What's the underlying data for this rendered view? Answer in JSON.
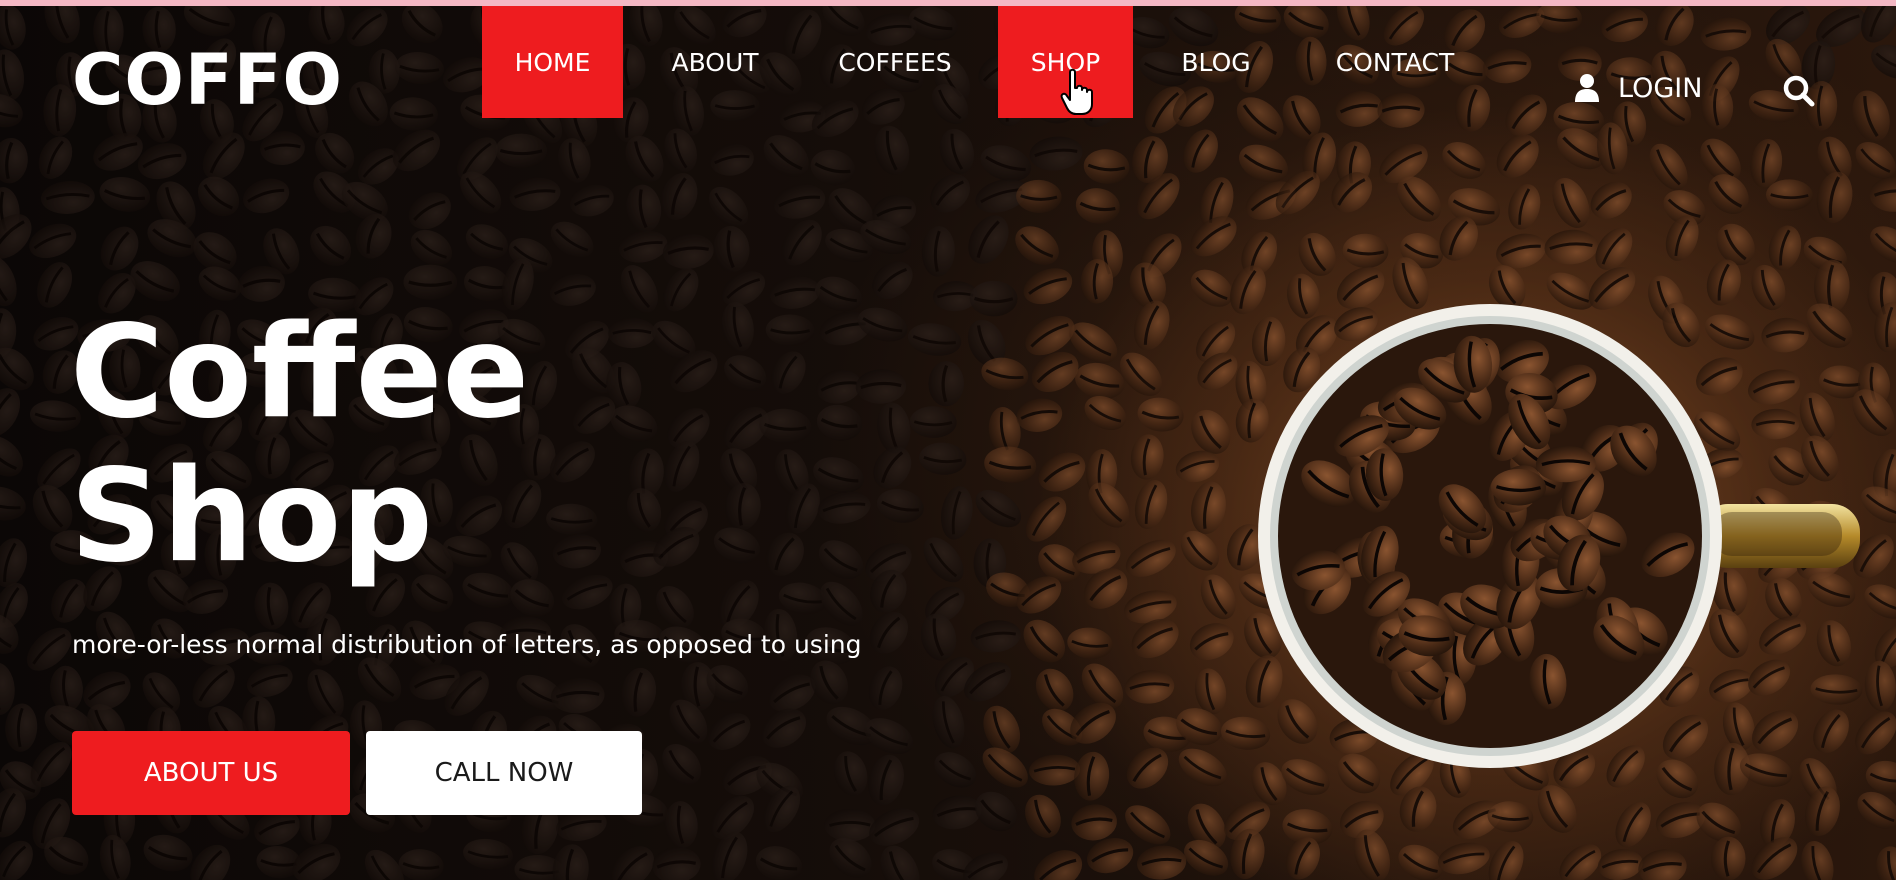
{
  "brand": {
    "logo_text": "COFFO"
  },
  "nav": {
    "items": [
      {
        "label": "HOME",
        "active": true
      },
      {
        "label": "ABOUT",
        "active": false
      },
      {
        "label": "COFFEES",
        "active": false
      },
      {
        "label": "SHOP",
        "active": true
      },
      {
        "label": "BLOG",
        "active": false
      },
      {
        "label": "CONTACT",
        "active": false
      }
    ],
    "login_label": "LOGIN"
  },
  "hero": {
    "title_line1": "Coffee",
    "title_line2": "Shop",
    "subtitle": "more-or-less normal distribution of letters, as opposed to using",
    "primary_button": "ABOUT US",
    "secondary_button": "CALL NOW"
  },
  "icons": {
    "user": "user-icon",
    "search": "search-icon",
    "cursor": "hand-pointer-icon"
  },
  "colors": {
    "accent": "#ee1c1f",
    "text": "#ffffff",
    "button_alt_bg": "#ffffff",
    "button_alt_text": "#1a1a1a"
  }
}
